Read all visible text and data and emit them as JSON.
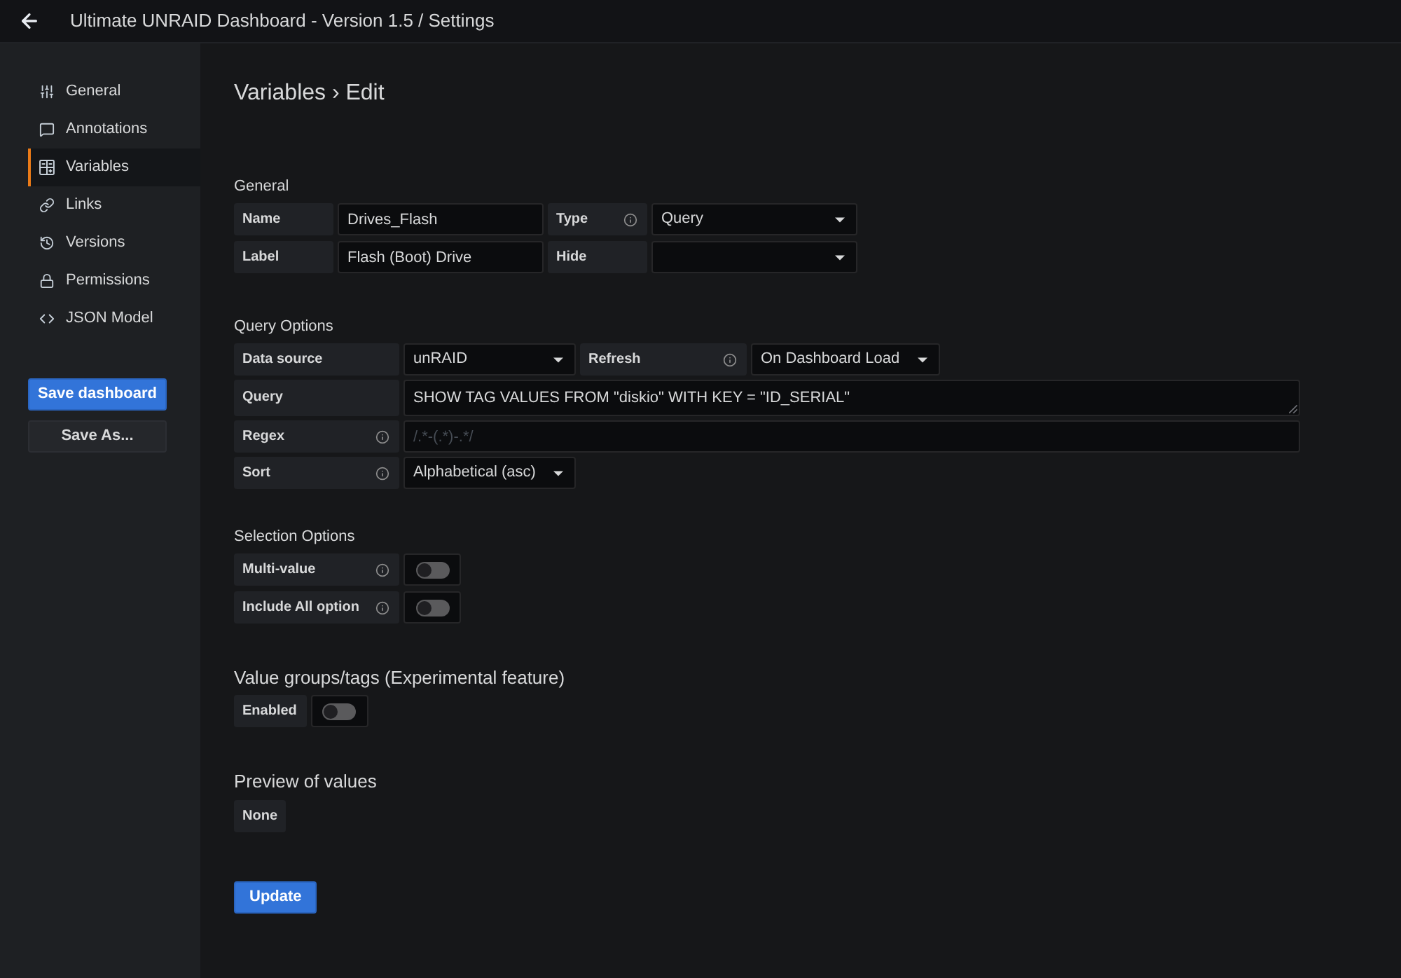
{
  "header": {
    "title": "Ultimate UNRAID Dashboard - Version 1.5 / Settings"
  },
  "sidebar": {
    "items": [
      {
        "label": "General",
        "selected": false
      },
      {
        "label": "Annotations",
        "selected": false
      },
      {
        "label": "Variables",
        "selected": true
      },
      {
        "label": "Links",
        "selected": false
      },
      {
        "label": "Versions",
        "selected": false
      },
      {
        "label": "Permissions",
        "selected": false
      },
      {
        "label": "JSON Model",
        "selected": false
      }
    ],
    "buttons": [
      {
        "label": "Save dashboard",
        "kind": "primary"
      },
      {
        "label": "Save As...",
        "kind": "secondary"
      }
    ]
  },
  "page": {
    "title": "Variables › Edit"
  },
  "general": {
    "heading": "General",
    "name": {
      "label": "Name",
      "value": "Drives_Flash"
    },
    "type": {
      "label": "Type",
      "value": "Query"
    },
    "label": {
      "label": "Label",
      "value": "Flash (Boot) Drive"
    },
    "hide": {
      "label": "Hide"
    }
  },
  "query_options": {
    "heading": "Query Options",
    "data_source": {
      "label": "Data source",
      "value": "unRAID"
    },
    "refresh": {
      "label": "Refresh",
      "value": "On Dashboard Load"
    },
    "query": {
      "label": "Query",
      "value": "SHOW TAG VALUES FROM \"diskio\" WITH KEY = \"ID_SERIAL\""
    },
    "regex": {
      "label": "Regex",
      "placeholder": "/.*-(.*)-.*/"
    },
    "sort": {
      "label": "Sort",
      "value": "Alphabetical (asc)"
    }
  },
  "selection_options": {
    "heading": "Selection Options",
    "switches": [
      {
        "label": "Multi-value",
        "on": false
      },
      {
        "label": "Include All option",
        "on": false
      }
    ]
  },
  "value_groups": {
    "heading": "Value groups/tags (Experimental feature)",
    "switches": [
      {
        "label": "Enabled",
        "on": false
      }
    ]
  },
  "preview": {
    "heading": "Preview of values",
    "values": [
      "None"
    ]
  },
  "update_button": {
    "label": "Update"
  }
}
